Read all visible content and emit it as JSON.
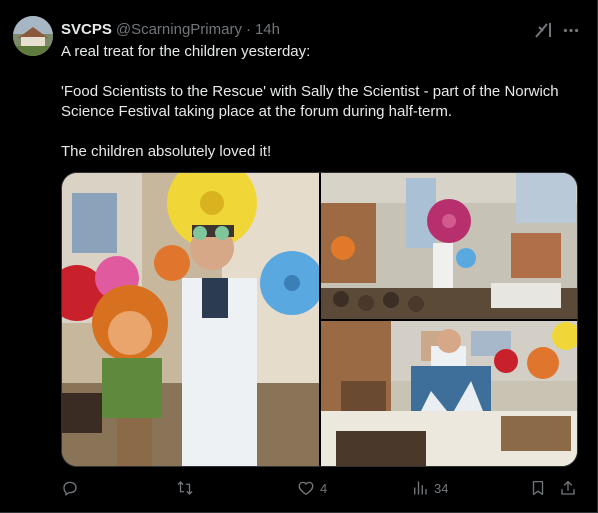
{
  "author": {
    "name": "SVCPS",
    "handle": "@ScarningPrimary",
    "separator": "·",
    "timestamp": "14h"
  },
  "tweet": {
    "paragraphs": [
      "A real treat for the children yesterday:",
      "'Food Scientists to the Rescue' with Sally the Scientist - part of the Norwich Science Festival taking place at the forum during half-term.",
      "The children absolutely loved it!"
    ]
  },
  "media": {
    "photos": [
      {
        "subject": "scientist-with-puppet"
      },
      {
        "subject": "hall-audience"
      },
      {
        "subject": "presentation-poster"
      }
    ]
  },
  "actions": {
    "reply_count": "",
    "retweet_count": "",
    "like_count": "4",
    "views_count": "34"
  },
  "icons": [
    "grok-icon",
    "more-icon",
    "reply-icon",
    "retweet-icon",
    "like-icon",
    "views-icon",
    "bookmark-icon",
    "share-icon"
  ],
  "colors": {
    "background": "#000000",
    "text": "#e7e9ea",
    "muted": "#71767b",
    "border": "#2f3336"
  }
}
